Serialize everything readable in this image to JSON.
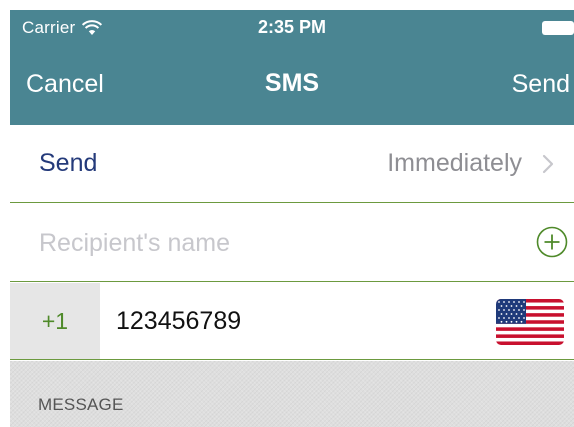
{
  "status_bar": {
    "carrier": "Carrier",
    "time": "2:35 PM",
    "wifi_icon": "wifi-icon",
    "battery_icon": "battery-icon"
  },
  "nav_bar": {
    "cancel_label": "Cancel",
    "title": "SMS",
    "send_label": "Send"
  },
  "form": {
    "send_row": {
      "label": "Send",
      "value": "Immediately",
      "icon": "chevron-right-icon"
    },
    "recipient_row": {
      "placeholder": "Recipient's name",
      "value": "",
      "icon": "add-circle-icon"
    },
    "phone_row": {
      "country_code": "+1",
      "number": "123456789",
      "flag_icon": "us-flag-icon"
    },
    "message_section": {
      "label": "MESSAGE"
    }
  },
  "colors": {
    "header_bg": "#4a8592",
    "send_label": "#243a7a",
    "accent_green": "#4f8a2a",
    "separator": "#6c9a3f",
    "country_code_bg": "#e6e6e6"
  }
}
